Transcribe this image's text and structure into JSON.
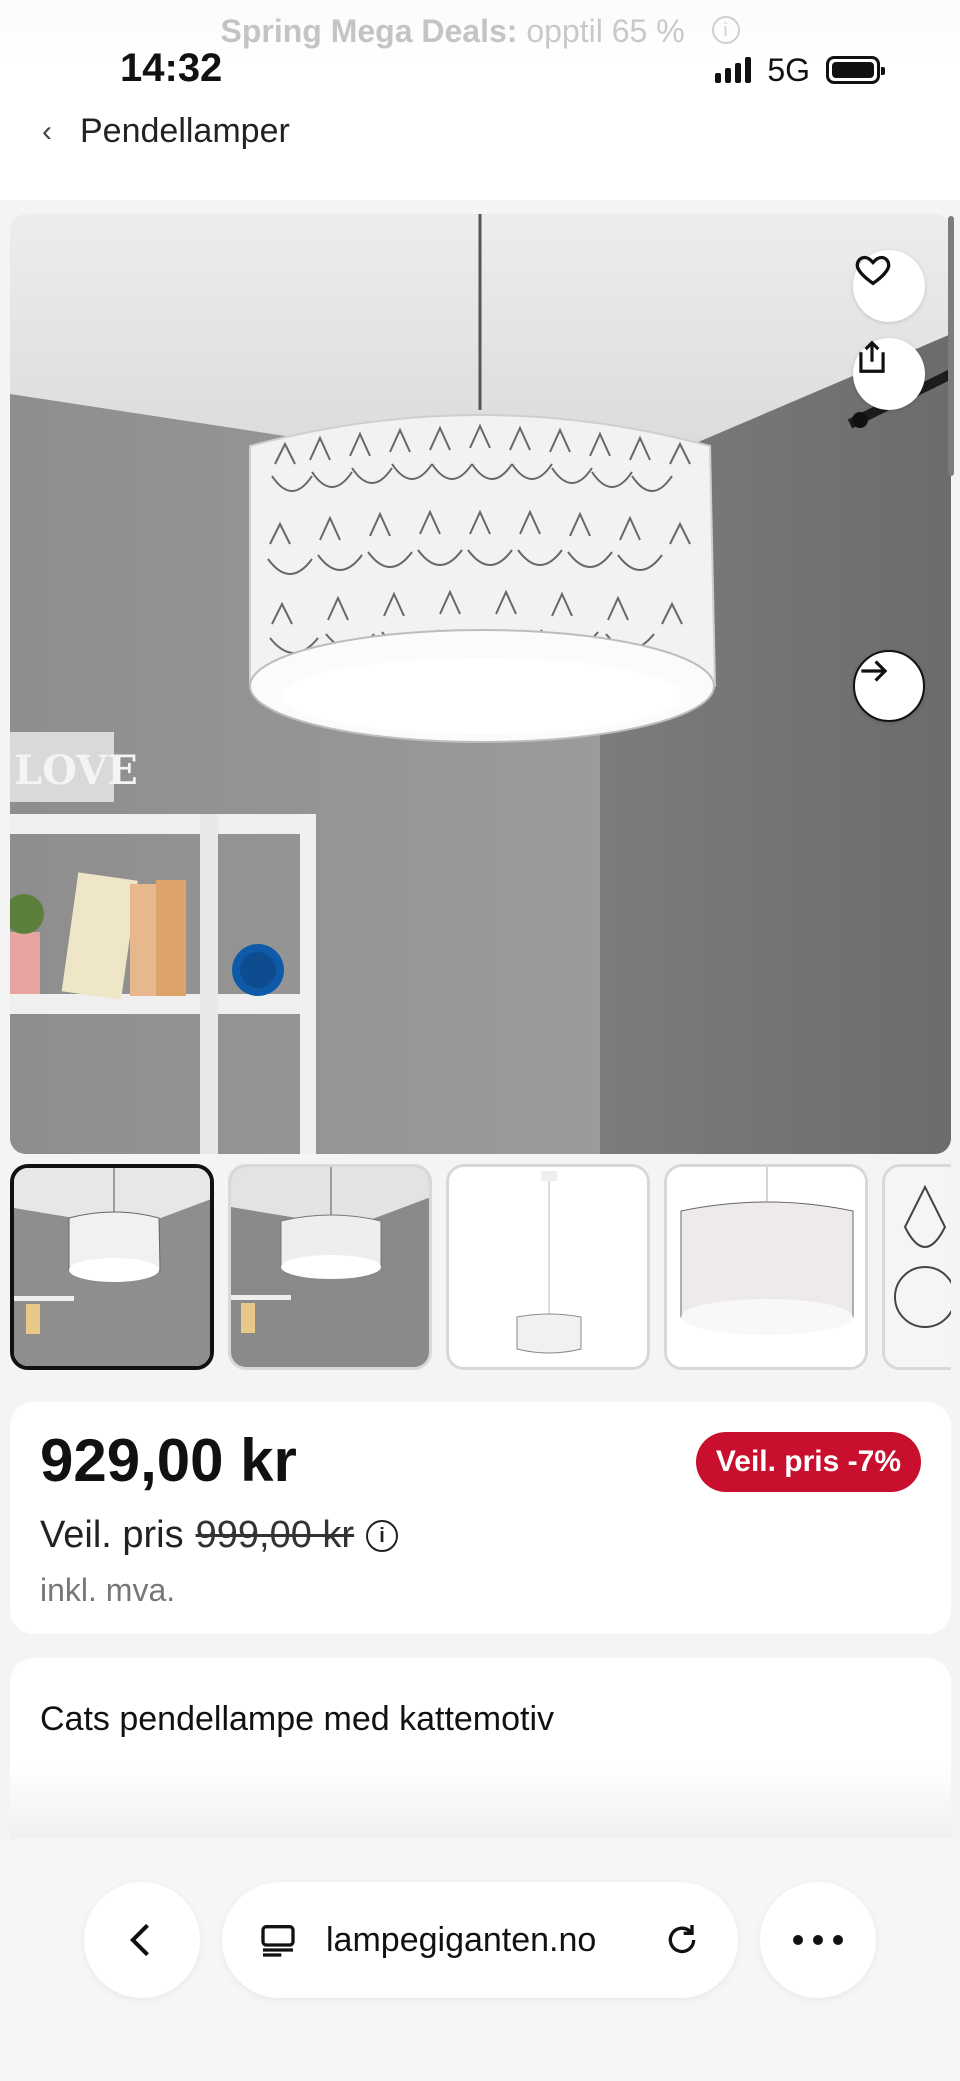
{
  "promo": {
    "bold": "Spring Mega Deals:",
    "rest": "opptil 65 %",
    "info_glyph": "i"
  },
  "status_bar": {
    "time": "14:32",
    "network": "5G"
  },
  "breadcrumb": {
    "back_glyph": "‹",
    "label": "Pendellamper"
  },
  "hero": {
    "favorite_icon": "heart-icon",
    "share_icon": "share-icon",
    "next_icon": "arrow-right-icon",
    "sign_text": "LOVE"
  },
  "thumbnails": [
    {
      "kind": "room-photo",
      "active": true
    },
    {
      "kind": "room-photo",
      "active": false
    },
    {
      "kind": "product-white",
      "active": false
    },
    {
      "kind": "shade-closeup",
      "active": false
    },
    {
      "kind": "pattern-closeup",
      "active": false
    }
  ],
  "price": {
    "current": "929,00 kr",
    "ref_label": "Veil. pris",
    "ref_price": "999,00 kr",
    "vat": "inkl. mva.",
    "badge": "Veil. pris -7%",
    "info_glyph": "i"
  },
  "product": {
    "title": "Cats pendellampe med kattemotiv"
  },
  "browser": {
    "url": "lampegiganten.no",
    "back_icon": "chevron-left-icon",
    "tabs_icon": "reader-icon",
    "reload_icon": "reload-icon",
    "more_icon": "more-icon"
  },
  "colors": {
    "badge_red": "#c8102e",
    "text_dark": "#111111",
    "muted": "#777777"
  }
}
